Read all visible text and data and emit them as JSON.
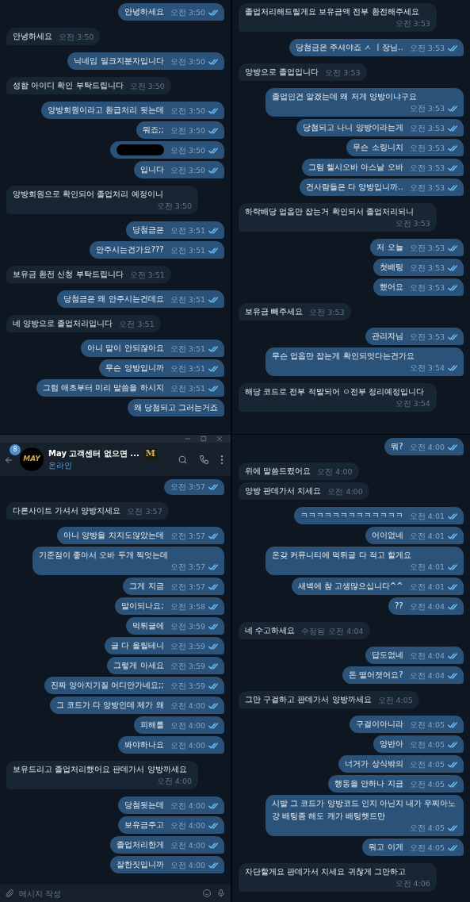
{
  "panels": [
    {
      "messages": [
        {
          "kind": "out",
          "text": "안녕하세요",
          "time": "오전 3:50",
          "read": true
        },
        {
          "kind": "in",
          "text": "안녕하세요",
          "time": "오전 3:50"
        },
        {
          "kind": "out",
          "text": "닉네임 밀크지분자입니다",
          "time": "오전 3:50",
          "read": true
        },
        {
          "kind": "in",
          "text": "성함 아이디 확인 부탁드립니다",
          "time": "오전 3:50"
        },
        {
          "kind": "out",
          "text": "양방회원이라고 환급처리 됫는데",
          "time": "오전 3:50",
          "read": true
        },
        {
          "kind": "out",
          "text": "뭐죠;;",
          "time": "오전 3:50",
          "read": true
        },
        {
          "kind": "redacted",
          "time": "오전 3:50",
          "read": true
        },
        {
          "kind": "out",
          "text": "입니다",
          "time": "오전 3:50",
          "read": true
        },
        {
          "kind": "in",
          "text": "양방회원으로 확인되어 졸업처리 예정이니",
          "time": "오전 3:50"
        },
        {
          "kind": "out",
          "text": "당첨금은",
          "time": "오전 3:51",
          "read": true
        },
        {
          "kind": "out",
          "text": "안주시는건가요???",
          "time": "오전 3:51",
          "read": true
        },
        {
          "kind": "in",
          "text": "보유금 환전 신청 부탁드립니다",
          "time": "오전 3:51"
        },
        {
          "kind": "out",
          "text": "당첨금은 왜 안주시는건데요",
          "time": "오전 3:51",
          "read": true
        },
        {
          "kind": "in",
          "text": "네 양방으로 졸업처리입니다",
          "time": "오전 3:51"
        },
        {
          "kind": "out",
          "text": "아니 말이 안되잖아요",
          "time": "오전 3:51",
          "read": true
        },
        {
          "kind": "out",
          "text": "무슨 양방입니까",
          "time": "오전 3:51",
          "read": true
        },
        {
          "kind": "out",
          "text": "그럼 애초부터 미리 말씀을 하시지",
          "time": "오전 3:51",
          "read": true
        },
        {
          "kind": "out",
          "text": "왜 당첨되고 그러는거죠"
        }
      ]
    },
    {
      "messages": [
        {
          "kind": "in",
          "text": "졸업처리해드릴게요 보유금액 전부 환전해주세요",
          "time": "오전 3:53"
        },
        {
          "kind": "out",
          "text": "당첨금은 주셔야죠 ㅅ ㅣ장님..",
          "time": "오전 3:53",
          "read": true
        },
        {
          "kind": "in",
          "text": "양방으로 졸업입니다",
          "time": "오전 3:53"
        },
        {
          "kind": "out",
          "text": "졸업인건 알겠는데 왜 저게 양방이냐구요",
          "time": "오전 3:53",
          "read": true
        },
        {
          "kind": "out",
          "text": "당첨되고 나니 양방이라는게",
          "time": "오전 3:53",
          "read": true
        },
        {
          "kind": "out",
          "text": "무슨 소링니치",
          "time": "오전 3:53",
          "read": true
        },
        {
          "kind": "out",
          "text": "그럼 첼시오바 아스날 오바",
          "time": "오전 3:53",
          "read": true
        },
        {
          "kind": "out",
          "text": "건사람들은 다 양방입니까..",
          "time": "오전 3:53",
          "read": true
        },
        {
          "kind": "in",
          "text": "하락배당 업옵만 잡는거 확인되서 졸업처리되니",
          "time": "오전 3:53"
        },
        {
          "kind": "out",
          "text": "저 오늘",
          "time": "오전 3:53",
          "read": true
        },
        {
          "kind": "out",
          "text": "첫배팅",
          "time": "오전 3:53",
          "read": true
        },
        {
          "kind": "out",
          "text": "했어요",
          "time": "오전 3:53",
          "read": true
        },
        {
          "kind": "in",
          "text": "보유금 빼주세요",
          "time": "오전 3:53"
        },
        {
          "kind": "out",
          "text": "관리자님",
          "time": "오전 3:53",
          "read": true
        },
        {
          "kind": "out",
          "text": "무슨 업옵만 잡는게 확인되엇다는건가요",
          "time": "오전 3:54",
          "read": true
        },
        {
          "kind": "in",
          "text": "해당 코드로 전부 적발되어 ㅇ전부 정리예정입니다",
          "time": "오전 3:54"
        }
      ]
    },
    {
      "header": {
        "badge": "8",
        "avatar_text": "MAY",
        "title": "May 고객센터 없으면 ...",
        "mark": "M",
        "status": "온라인"
      },
      "messages": [
        {
          "kind": "out",
          "time": "오전 3:57",
          "read": true
        },
        {
          "kind": "in",
          "text": "다른사이트 가셔서 양방치세요",
          "time": "오전 3:57"
        },
        {
          "kind": "out",
          "text": "아니 양방을 치지도않았는데",
          "time": "오전 3:57",
          "read": true
        },
        {
          "kind": "out",
          "text": "기준점이 좋아서 오바 두개 찍엇는데",
          "time": "오전 3:57",
          "read": true
        },
        {
          "kind": "out",
          "text": "그게 지금",
          "time": "오전 3:57",
          "read": true
        },
        {
          "kind": "out",
          "text": "말이되나요;",
          "time": "오전 3:58",
          "read": true
        },
        {
          "kind": "out",
          "text": "먹튀글에",
          "time": "오전 3:59",
          "read": true
        },
        {
          "kind": "out",
          "text": "글 다 올릴테니",
          "time": "오전 3:59",
          "read": true
        },
        {
          "kind": "out",
          "text": "그렇게 아세요",
          "time": "오전 3:59",
          "read": true
        },
        {
          "kind": "out",
          "text": "진짜 양아치기질 어디안가네요;;",
          "time": "오전 3:59",
          "read": true
        },
        {
          "kind": "out",
          "text": "그 코드가 다 양방인데 제가 왜",
          "time": "오전 4:00",
          "read": true
        },
        {
          "kind": "out",
          "text": "피해를",
          "time": "오전 4:00",
          "read": true
        },
        {
          "kind": "out",
          "text": "봐야하나요",
          "time": "오전 4:00",
          "read": true
        },
        {
          "kind": "in",
          "text": "보유드리고 졸업처리했어요 판데가서 양방까세요",
          "time": "오전 4:00"
        },
        {
          "kind": "out",
          "text": "당첨됫는데",
          "time": "오전 4:00",
          "read": true
        },
        {
          "kind": "out",
          "text": "보유금주고",
          "time": "오전 4:00",
          "read": true
        },
        {
          "kind": "out",
          "text": "졸업처리한게",
          "time": "오전 4:00",
          "read": true
        },
        {
          "kind": "out",
          "text": "잘한짓입니까",
          "time": "오전 4:00",
          "read": true
        }
      ],
      "composer": {
        "placeholder": "메시지 작성"
      }
    },
    {
      "messages": [
        {
          "kind": "out",
          "text": "뭐?",
          "time": "오전 4:00",
          "read": true
        },
        {
          "kind": "in",
          "text": "위에 말씀드렸어요",
          "time": "오전 4:00"
        },
        {
          "kind": "in",
          "text": "양방 판데가서 치세요",
          "time": "오전 4:00"
        },
        {
          "kind": "out",
          "text": "ㅋㅋㅋㅋㅋㅋㅋㅋㅋㅋㅋㅋㅋ",
          "time": "오전 4:01",
          "read": true
        },
        {
          "kind": "out",
          "text": "어이없네",
          "time": "오전 4:01",
          "read": true
        },
        {
          "kind": "out",
          "text": "온갖 커뮤니티에 먹튀글 다 적고 할게요",
          "time": "오전 4:01",
          "read": true
        },
        {
          "kind": "out",
          "text": "새벽에 참 고생많으십니다^^",
          "time": "오전 4:01",
          "read": true
        },
        {
          "kind": "out",
          "text": "??",
          "time": "오전 4:04",
          "read": true
        },
        {
          "kind": "in",
          "text": "네 수고하세요",
          "edited": "수정됨",
          "time": "오전 4:04"
        },
        {
          "kind": "out",
          "text": "답도없네",
          "time": "오전 4:04",
          "read": true
        },
        {
          "kind": "out",
          "text": "돈 떨어졋어요?",
          "time": "오전 4:04",
          "read": true
        },
        {
          "kind": "in",
          "text": "그만 구걸하고 판데가서 양방까세요",
          "time": "오전 4:05"
        },
        {
          "kind": "out",
          "text": "구걸이아니라",
          "time": "오전 4:05",
          "read": true
        },
        {
          "kind": "out",
          "text": "양반아",
          "time": "오전 4:05",
          "read": true
        },
        {
          "kind": "out",
          "text": "너거가 상식밖의",
          "time": "오전 4:05",
          "read": true
        },
        {
          "kind": "out",
          "text": "행동을 안하나 지금",
          "time": "오전 4:05",
          "read": true
        },
        {
          "kind": "out",
          "text": "시발 그 코드가 양방코드 인지 아닌지 내가 우찌아노 걍 배팅좀 해도 캐가 배팅햇드만",
          "time": "오전 4:05",
          "read": true
        },
        {
          "kind": "out",
          "text": "뭐고 이게",
          "time": "오전 4:05",
          "read": true
        },
        {
          "kind": "in",
          "text": "차단할게요 판데가서 치세요 귀찮게 그만하고",
          "time": "오전 4:06"
        }
      ]
    }
  ]
}
